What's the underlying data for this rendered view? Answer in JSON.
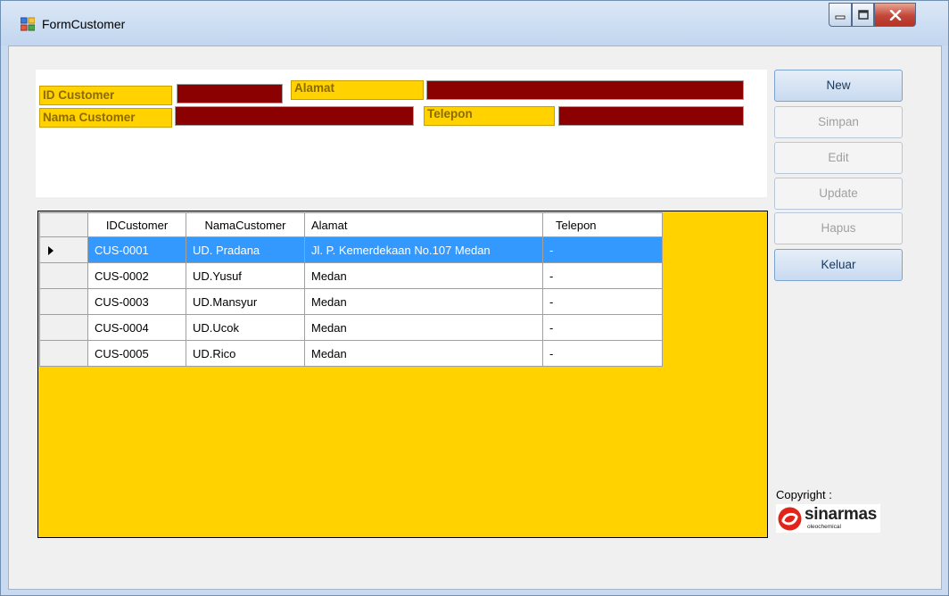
{
  "window": {
    "title": "FormCustomer"
  },
  "form": {
    "id_customer_label": "ID Customer",
    "nama_customer_label": "Nama Customer",
    "alamat_label": "Alamat",
    "telepon_label": "Telepon",
    "id_customer_value": "",
    "nama_customer_value": "",
    "alamat_value": "",
    "telepon_value": ""
  },
  "buttons": {
    "new": "New",
    "simpan": "Simpan",
    "edit": "Edit",
    "update": "Update",
    "hapus": "Hapus",
    "keluar": "Keluar"
  },
  "grid": {
    "columns": [
      "IDCustomer",
      "NamaCustomer",
      "Alamat",
      "Telepon"
    ],
    "rows": [
      [
        "CUS-0001",
        "UD. Pradana",
        "Jl. P. Kemerdekaan No.107 Medan",
        "-"
      ],
      [
        "CUS-0002",
        "UD.Yusuf",
        "Medan",
        "-"
      ],
      [
        "CUS-0003",
        "UD.Mansyur",
        "Medan",
        "-"
      ],
      [
        "CUS-0004",
        "UD.Ucok",
        "Medan",
        "-"
      ],
      [
        "CUS-0005",
        "UD.Rico",
        "Medan",
        "-"
      ]
    ],
    "selected_row": 0
  },
  "footer": {
    "copyright": "Copyright :",
    "logo_text": "sinarmas",
    "logo_sub": "oleochemical"
  },
  "colors": {
    "label_bg": "#ffd200",
    "textbox_bg": "#8b0000",
    "grid_bg": "#ffd200",
    "selection": "#3399ff"
  }
}
